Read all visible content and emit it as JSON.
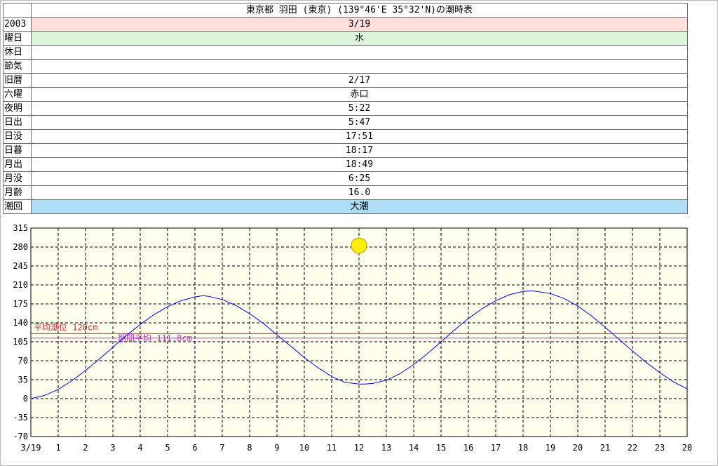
{
  "info_table": {
    "title": "東京都 羽田 (東京) (139°46'E 35°32'N)の潮時表",
    "rows": [
      {
        "label": "2003",
        "value": "3/19",
        "color": "#ffdede"
      },
      {
        "label": "曜日",
        "value": "水",
        "color": "#ddf7dd"
      },
      {
        "label": "休日",
        "value": ""
      },
      {
        "label": "節気",
        "value": ""
      },
      {
        "label": "旧暦",
        "value": "2/17"
      },
      {
        "label": "六曜",
        "value": "赤口"
      },
      {
        "label": "夜明",
        "value": "5:22"
      },
      {
        "label": "日出",
        "value": "5:47"
      },
      {
        "label": "日没",
        "value": "17:51"
      },
      {
        "label": "日暮",
        "value": "18:17"
      },
      {
        "label": "月出",
        "value": "18:49"
      },
      {
        "label": "月没",
        "value": "6:25"
      },
      {
        "label": "月齢",
        "value": "16.0"
      },
      {
        "label": "潮回",
        "value": "大潮",
        "color": "#aeddf6"
      }
    ]
  },
  "chart_data": {
    "type": "line",
    "title": "",
    "xlabel": "",
    "ylabel": "",
    "x_tick_labels": [
      "3/19",
      "1",
      "2",
      "3",
      "4",
      "5",
      "6",
      "7",
      "8",
      "9",
      "10",
      "11",
      "12",
      "13",
      "14",
      "15",
      "16",
      "17",
      "18",
      "19",
      "20",
      "21",
      "22",
      "23",
      "20"
    ],
    "xlim": [
      0,
      24
    ],
    "ylim": [
      -70,
      315
    ],
    "y_ticks": [
      315,
      280,
      245,
      210,
      175,
      140,
      105,
      70,
      35,
      0,
      -35,
      -70
    ],
    "grid": true,
    "series": [
      {
        "x": [
          0,
          0.5,
          1,
          1.5,
          2,
          2.5,
          3,
          3.5,
          4,
          4.5,
          5,
          5.5,
          6,
          6.3,
          6.5,
          7,
          7.5,
          8,
          8.5,
          9,
          9.5,
          10,
          10.5,
          11,
          11.5,
          12,
          12.2,
          12.5,
          13,
          13.5,
          14,
          14.5,
          15,
          15.5,
          16,
          16.5,
          17,
          17.5,
          18,
          18.3,
          18.5,
          19,
          19.5,
          20,
          20.5,
          21,
          21.5,
          22,
          22.5,
          23,
          23.5,
          24
        ],
        "y": [
          0,
          6,
          17,
          33,
          52,
          73,
          95,
          117,
          137,
          155,
          170,
          181,
          188,
          190,
          189,
          183,
          172,
          157,
          139,
          118,
          97,
          76,
          57,
          41,
          30,
          27,
          27,
          28,
          34,
          46,
          63,
          83,
          105,
          127,
          148,
          166,
          181,
          192,
          198,
          199,
          198,
          194,
          185,
          171,
          153,
          132,
          110,
          88,
          67,
          48,
          31,
          18
        ],
        "color": "#0000ff"
      }
    ],
    "reference_lines": [
      {
        "y": 120,
        "label": "平均潮位 120cm",
        "color": "#cc3333"
      },
      {
        "y": 111.8,
        "label": "期間平均 111.8cm",
        "color": "#cc33cc"
      }
    ],
    "annotations": [
      {
        "type": "sun",
        "x": 12,
        "y": 280,
        "color": "#ffee00"
      }
    ],
    "colors": {
      "background": "#ffffee",
      "grid": "#000000"
    }
  }
}
